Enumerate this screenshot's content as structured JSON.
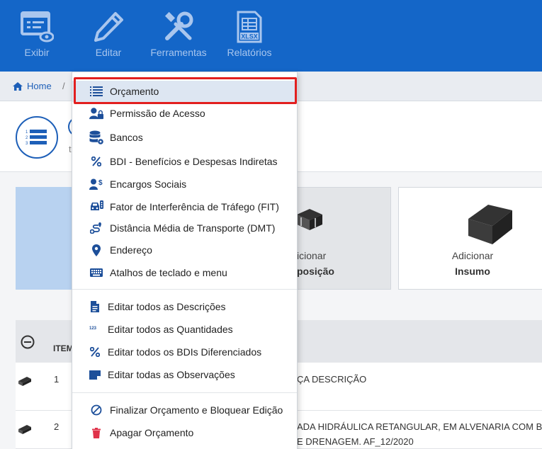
{
  "toolbar": {
    "items": [
      {
        "label": "Exibir",
        "icon": "view-icon"
      },
      {
        "label": "Editar",
        "icon": "pencil-icon"
      },
      {
        "label": "Ferramentas",
        "icon": "tools-icon"
      },
      {
        "label": "Relatórios",
        "icon": "xlsx-icon"
      }
    ],
    "xlsx_badge": "XLSX"
  },
  "breadcrumb": {
    "home": "Home",
    "separator": "/"
  },
  "header": {
    "peek_text": "t"
  },
  "cards": {
    "middle_label": "icionar",
    "middle_sub": "posição",
    "right_label": "Adicionar",
    "right_sub": "Insumo"
  },
  "table": {
    "header_col": "ITEM",
    "rows": [
      {
        "item": "1",
        "desc": "ÇA DESCRIÇÃO"
      },
      {
        "item": "2",
        "desc_line1": "ADA HIDRÁULICA RETANGULAR, EM ALVENARIA COM B",
        "desc_line2": "E DRENAGEM. AF_12/2020"
      }
    ]
  },
  "menu": {
    "group1": [
      {
        "label": "Orçamento",
        "icon": "list-icon",
        "selected": true
      },
      {
        "label": "Permissão de Acesso",
        "icon": "user-lock-icon"
      },
      {
        "label": "Bancos",
        "icon": "database-gear-icon"
      },
      {
        "label": "BDI - Benefícios e Despesas Indiretas",
        "icon": "percent-icon"
      },
      {
        "label": "Encargos Sociais",
        "icon": "user-dollar-icon"
      },
      {
        "label": "Fator de Interferência de Tráfego (FIT)",
        "icon": "traffic-car-icon"
      },
      {
        "label": "Distância Média de Transporte (DMT)",
        "icon": "route-icon"
      },
      {
        "label": "Endereço",
        "icon": "map-pin-icon"
      },
      {
        "label": "Atalhos de teclado e menu",
        "icon": "keyboard-icon"
      }
    ],
    "group2": [
      {
        "label": "Editar todos as Descrições",
        "icon": "document-icon"
      },
      {
        "label": "Editar todos as Quantidades",
        "icon": "numbers-icon"
      },
      {
        "label": "Editar todos os BDIs Diferenciados",
        "icon": "percent-icon"
      },
      {
        "label": "Editar todas as Observações",
        "icon": "note-icon"
      }
    ],
    "group3": [
      {
        "label": "Finalizar Orçamento e Bloquear Edição",
        "icon": "block-icon"
      },
      {
        "label": "Apagar Orçamento",
        "icon": "trash-icon"
      }
    ]
  },
  "colors": {
    "toolbar_bg": "#1466c8",
    "toolbar_text": "#a9c6ee",
    "accent": "#1d5fb8",
    "highlight_border": "#e21f1f",
    "trash": "#e0334a"
  }
}
